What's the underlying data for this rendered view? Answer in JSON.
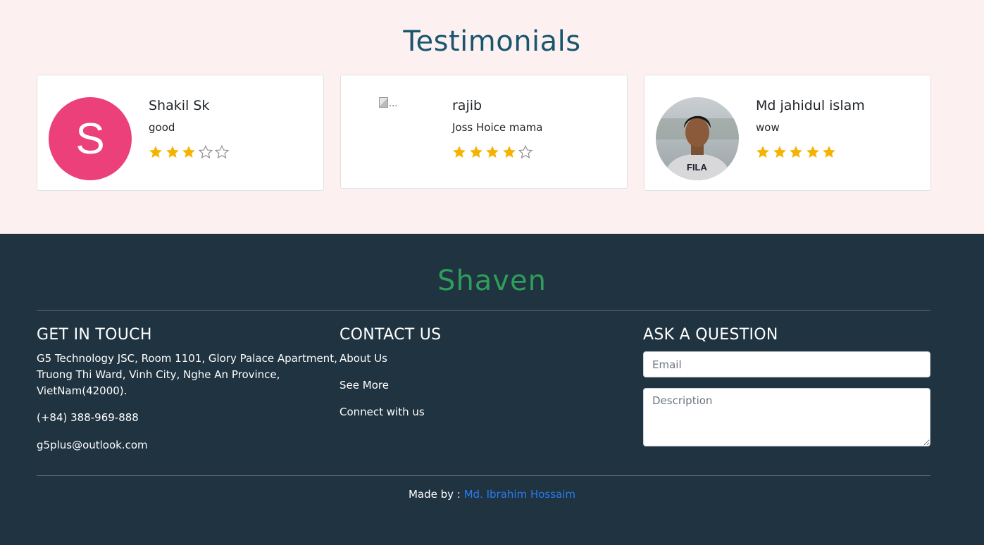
{
  "testimonials": {
    "heading": "Testimonials",
    "cards": [
      {
        "name": "Shakil Sk",
        "comment": "good",
        "rating": 3,
        "avatar": {
          "kind": "letter",
          "letter": "S",
          "color": "#ec407a"
        }
      },
      {
        "name": "rajib",
        "comment": "Joss Hoice mama",
        "rating": 4,
        "avatar": {
          "kind": "broken-image",
          "alt": "..."
        }
      },
      {
        "name": "Md jahidul islam",
        "comment": "wow",
        "rating": 5,
        "avatar": {
          "kind": "photo",
          "shirt_text": "FILA"
        }
      }
    ],
    "max_rating": 5
  },
  "footer": {
    "brand": "Shaven",
    "get_in_touch": {
      "heading": "GET IN TOUCH",
      "address_line1": "G5 Technology JSC, Room 1101, Glory Palace Apartment,",
      "address_line2": "Truong Thi Ward, Vinh City, Nghe An Province,",
      "address_line3": "VietNam(42000).",
      "phone": "(+84) 388-969-888",
      "email": "g5plus@outlook.com"
    },
    "contact_us": {
      "heading": "CONTACT US",
      "links": [
        "About Us",
        "See More",
        "Connect with us"
      ]
    },
    "ask_question": {
      "heading": "ASK A QUESTION",
      "email_placeholder": "Email",
      "description_placeholder": "Description"
    },
    "made_by_label": "Made by :",
    "made_by_name": "Md. Ibrahim Hossaim"
  },
  "colors": {
    "testimonial_bg": "#fdf0f1",
    "heading": "#18566e",
    "footer_bg": "#1f3340",
    "brand": "#2f9e5a",
    "star": "#f5b301",
    "link": "#2a7bf4"
  }
}
